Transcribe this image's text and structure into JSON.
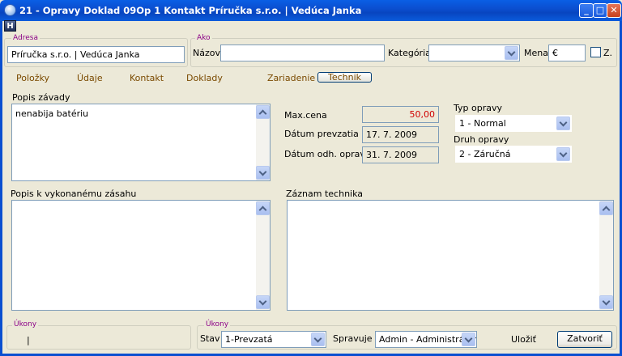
{
  "window": {
    "title": "21 - Opravy   Doklad 09Op 1   Kontakt Príručka s.r.o.  | Vedúca Janka",
    "minimize_label": "_",
    "maximize_label": "□",
    "close_label": "✕",
    "h_button_label": "H"
  },
  "address": {
    "legend": "Adresa",
    "value": "Príručka s.r.o. | Vedúca Janka"
  },
  "ako": {
    "legend": "Ako",
    "name_label": "Názov",
    "name_value": "",
    "category_label": "Kategória",
    "category_value": "",
    "currency_label": "Mena",
    "currency_value": "€",
    "z_label": "Z."
  },
  "tabs": [
    {
      "label": "Položky"
    },
    {
      "label": "Údaje"
    },
    {
      "label": "Kontakt"
    },
    {
      "label": "Doklady"
    },
    {
      "label": "Zariadenie"
    },
    {
      "label": "Technik"
    }
  ],
  "fault": {
    "label": "Popis závady",
    "value": "nenabija batériu"
  },
  "max_price": {
    "label": "Max.cena",
    "value": "50,00"
  },
  "date_received": {
    "label": "Dátum prevzatia",
    "value": "17. 7. 2009"
  },
  "date_estimated": {
    "label": "Dátum odh. opravy",
    "value": "31. 7. 2009"
  },
  "repair_type": {
    "label": "Typ opravy",
    "value": "1 - Normal"
  },
  "repair_kind": {
    "label": "Druh opravy",
    "value": "2 - Záručná"
  },
  "work_desc": {
    "label": "Popis k vykonanému zásahu",
    "value": ""
  },
  "tech_record": {
    "label": "Záznam technika",
    "value": ""
  },
  "ukony_left": {
    "legend": "Úkony",
    "value": "|"
  },
  "ukony_right": {
    "legend": "Úkony",
    "status_label": "Stav",
    "status_value": "1-Prevzatá",
    "manager_label": "Spravuje",
    "manager_value": "Admin - Administrátor"
  },
  "actions": {
    "save_label": "Uložiť",
    "close_label": "Zatvoriť"
  }
}
